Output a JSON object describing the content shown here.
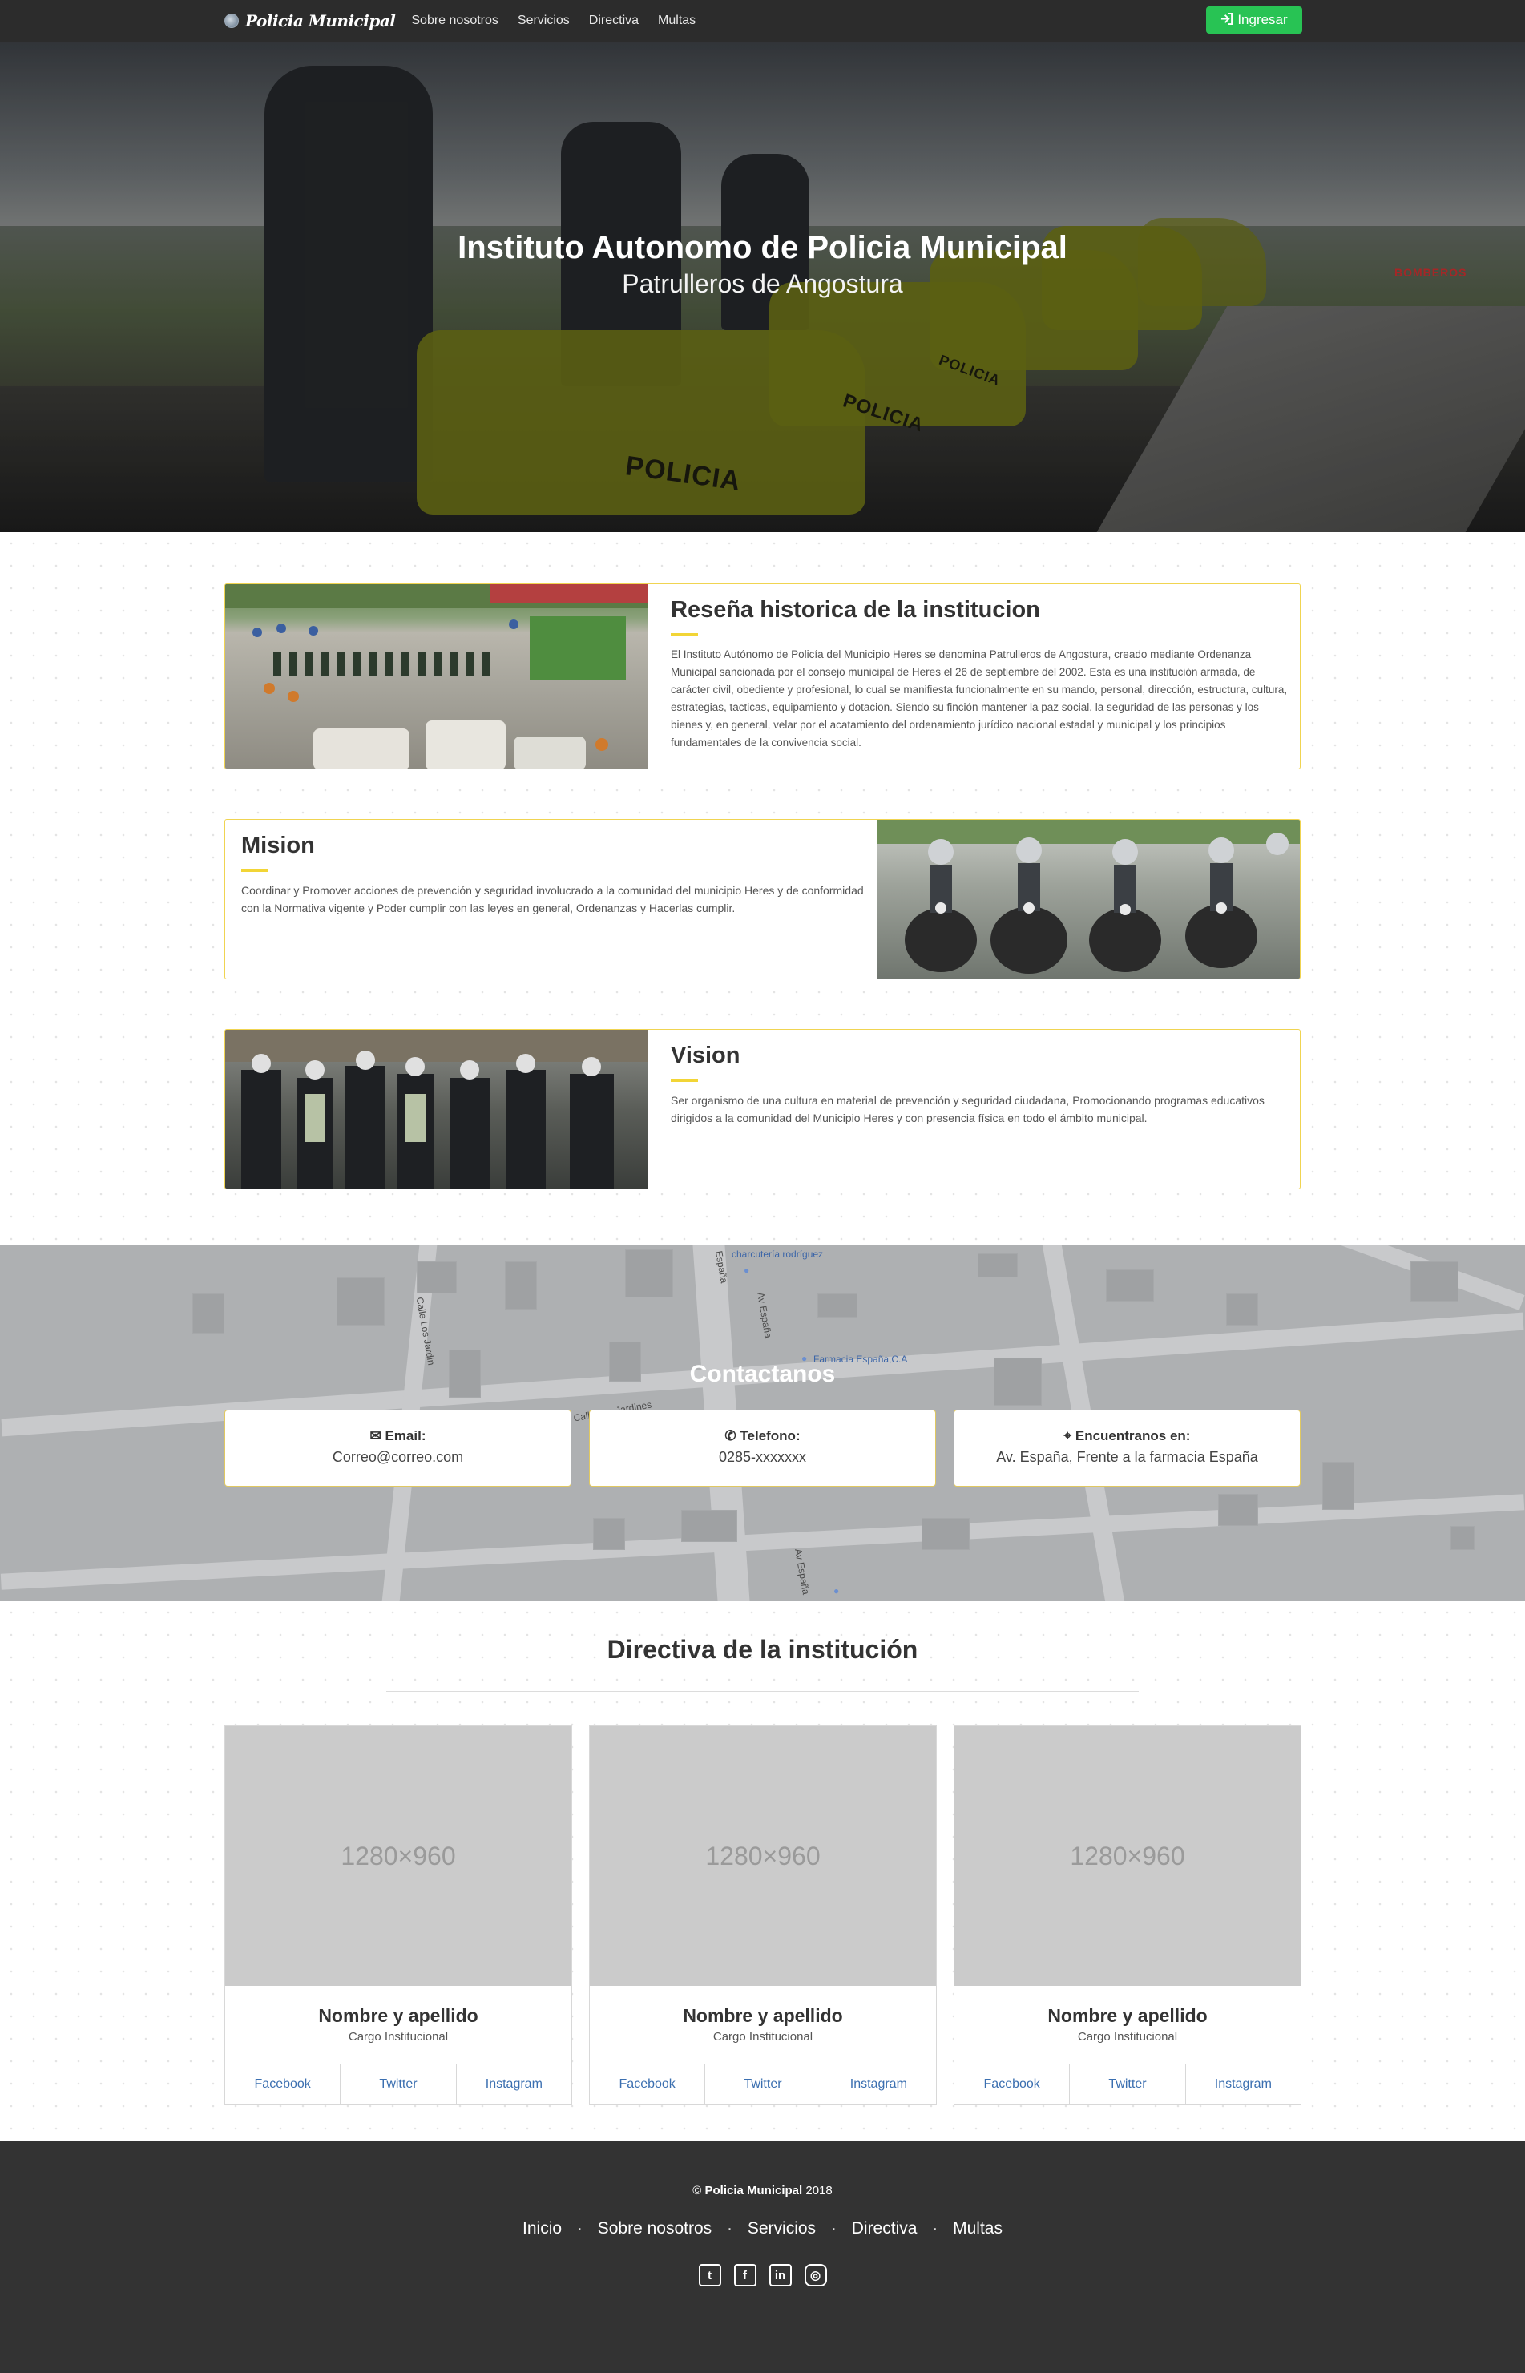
{
  "navbar": {
    "brand": "Policia Municipal",
    "links": [
      "Sobre nosotros",
      "Servicios",
      "Directiva",
      "Multas"
    ],
    "login_label": "Ingresar",
    "login_icon": "sign-in-icon",
    "login_color": "#28c354"
  },
  "hero": {
    "title": "Instituto Autonomo de Policia Municipal",
    "subtitle": "Patrulleros de Angostura",
    "moto_labels": [
      "POLICIA",
      "POLICIA",
      "POLICIA"
    ],
    "truck_label": "BOMBEROS"
  },
  "about": {
    "history": {
      "title": "Reseña historica de la institucion",
      "text": "El Instituto Autónomo de Policía del Municipio Heres se denomina Patrulleros de Angostura, creado mediante Ordenanza Municipal sancionada por el consejo municipal de Heres el 26 de septiembre del 2002. Esta es una institución armada, de carácter civil, obediente y profesional, lo cual se manifiesta funcionalmente en su mando, personal, dirección, estructura, cultura, estrategias, tacticas, equipamiento y dotacion. Siendo su finción mantener la paz social, la seguridad de las personas y los bienes y, en general, velar por el acatamiento del ordenamiento jurídico nacional estadal y municipal y los principios fundamentales de la convivencia social."
    },
    "mission": {
      "title": "Mision",
      "text": "Coordinar y Promover acciones de prevención y seguridad involucrado a la comunidad del municipio Heres y de conformidad con la Normativa vigente y Poder cumplir con las leyes en general, Ordenanzas y Hacerlas cumplir."
    },
    "vision": {
      "title": "Vision",
      "text": "Ser organismo de una cultura en material de prevención y seguridad ciudadana, Promocionando programas educativos dirigidos a la comunidad del Municipio Heres y con presencia física en todo el ámbito municipal."
    },
    "accent_color": "#f2d536"
  },
  "contact": {
    "title": "Contactanos",
    "map_labels": {
      "poi1": "charcutería rodríguez",
      "poi2": "Farmacia España,C.A",
      "street1": "Av España",
      "street2": "Calle Los Jardines",
      "street3": "Calle Los Jardin",
      "street4": "Av España",
      "street5": "España"
    },
    "cards": [
      {
        "icon": "envelope-icon",
        "label": "Email:",
        "value": "Correo@correo.com"
      },
      {
        "icon": "phone-icon",
        "label": "Telefono:",
        "value": "0285-xxxxxxx"
      },
      {
        "icon": "map-marker-icon",
        "label": "Encuentranos en:",
        "value": "Av. España, Frente a la farmacia España"
      }
    ]
  },
  "team": {
    "title": "Directiva de la institución",
    "members": [
      {
        "placeholder": "1280×960",
        "name": "Nombre y apellido",
        "role": "Cargo Institucional",
        "links": [
          "Facebook",
          "Twitter",
          "Instagram"
        ]
      },
      {
        "placeholder": "1280×960",
        "name": "Nombre y apellido",
        "role": "Cargo Institucional",
        "links": [
          "Facebook",
          "Twitter",
          "Instagram"
        ]
      },
      {
        "placeholder": "1280×960",
        "name": "Nombre y apellido",
        "role": "Cargo Institucional",
        "links": [
          "Facebook",
          "Twitter",
          "Instagram"
        ]
      }
    ]
  },
  "footer": {
    "copyright_prefix": "©",
    "copyright_brand": "Policia Municipal",
    "copyright_year": "2018",
    "links": [
      "Inicio",
      "Sobre nosotros",
      "Servicios",
      "Directiva",
      "Multas"
    ],
    "separator": "·",
    "socials": [
      {
        "icon": "twitter-icon",
        "glyph": "t"
      },
      {
        "icon": "facebook-icon",
        "glyph": "f"
      },
      {
        "icon": "linkedin-icon",
        "glyph": "in"
      },
      {
        "icon": "instagram-icon",
        "glyph": "◎"
      }
    ]
  }
}
